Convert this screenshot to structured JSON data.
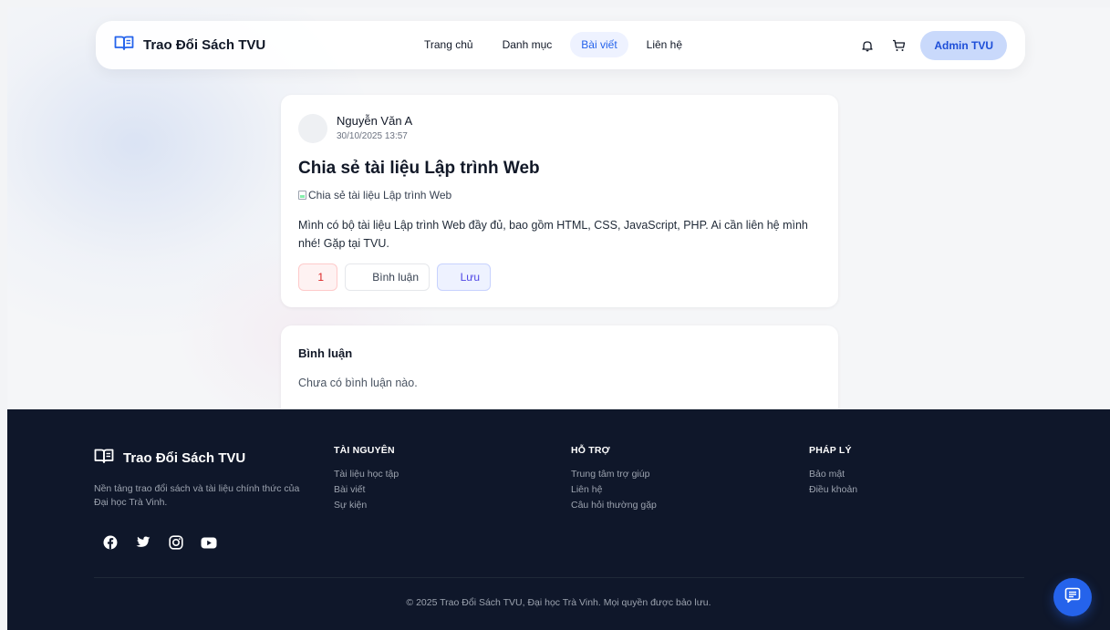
{
  "header": {
    "brand": "Trao Đổi Sách TVU",
    "nav": [
      {
        "label": "Trang chủ",
        "active": false
      },
      {
        "label": "Danh mục",
        "active": false
      },
      {
        "label": "Bài viết",
        "active": true
      },
      {
        "label": "Liên hệ",
        "active": false
      }
    ],
    "user": "Admin TVU"
  },
  "post": {
    "author": "Nguyễn Văn A",
    "time": "30/10/2025 13:57",
    "title": "Chia sẻ tài liệu Lập trình Web",
    "image_alt": "Chia sẻ tài liệu Lập trình Web",
    "body": "Mình có bộ tài liệu Lập trình Web đầy đủ, bao gồm HTML, CSS, JavaScript, PHP. Ai cần liên hệ mình nhé! Gặp tại TVU.",
    "likes": "1",
    "comment_label": "Bình luận",
    "save_label": "Lưu"
  },
  "comments": {
    "title": "Bình luận",
    "empty": "Chưa có bình luận nào."
  },
  "footer": {
    "brand": "Trao Đổi Sách TVU",
    "description": "Nền tảng trao đổi sách và tài liệu chính thức của Đại học Trà Vinh.",
    "columns": [
      {
        "title": "TÀI NGUYÊN",
        "links": [
          "Tài liệu học tập",
          "Bài viết",
          "Sự kiện"
        ]
      },
      {
        "title": "HỖ TRỢ",
        "links": [
          "Trung tâm trợ giúp",
          "Liên hệ",
          "Câu hỏi thường gặp"
        ]
      },
      {
        "title": "PHÁP LÝ",
        "links": [
          "Bảo mật",
          "Điều khoản"
        ]
      }
    ],
    "copyright": "© 2025 Trao Đổi Sách TVU, Đại học Trà Vinh. Mọi quyền được bảo lưu."
  },
  "colors": {
    "accent": "#2563eb",
    "footer_bg": "#0f172a",
    "like": "#dc2626"
  }
}
